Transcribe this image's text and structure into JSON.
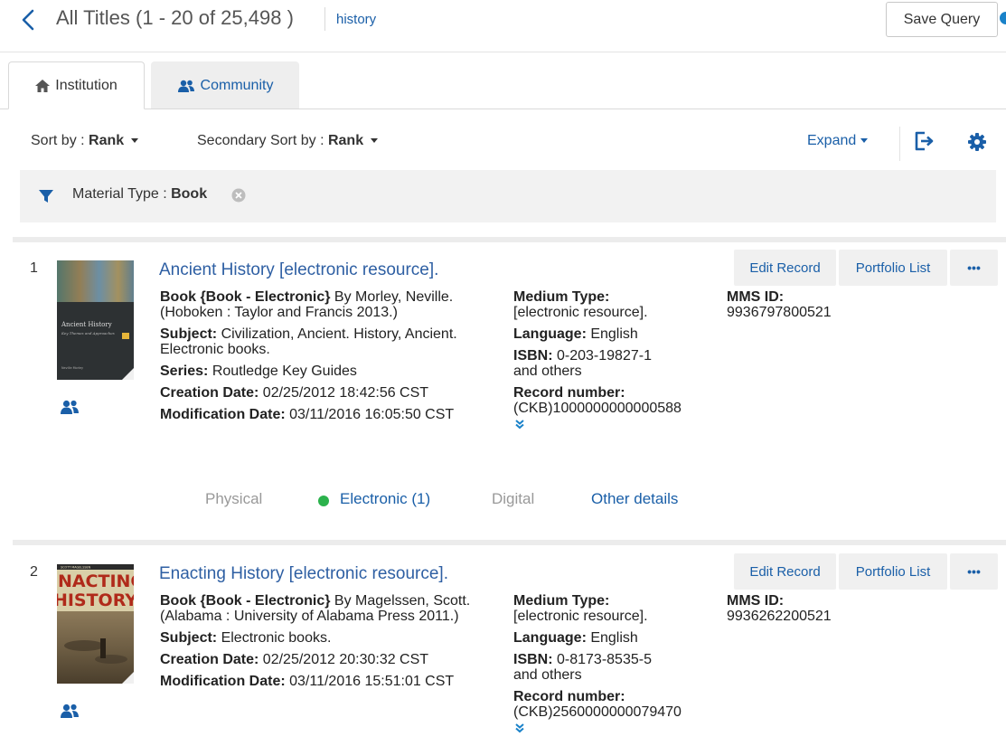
{
  "header": {
    "title": "All Titles (1 - 20 of 25,498 )",
    "query_term": "history",
    "save_query_label": "Save Query"
  },
  "tabs": [
    {
      "label": "Institution",
      "icon": "home-icon",
      "active": true
    },
    {
      "label": "Community",
      "icon": "users-icon",
      "active": false
    }
  ],
  "sort": {
    "sort_by_label": "Sort by : ",
    "sort_by_value": "Rank",
    "secondary_label": "Secondary Sort by : ",
    "secondary_value": "Rank",
    "expand_label": "Expand"
  },
  "filter": {
    "label": "Material Type : ",
    "value": "Book"
  },
  "colors": {
    "link": "#1a5fa8",
    "title_link": "#2e5fa3",
    "available_dot": "#2bb24c"
  },
  "results": [
    {
      "number": "1",
      "title": "Ancient History [electronic resource].",
      "book_type_label": "Book {Book - Electronic}",
      "book_line": " By Morley, Neville. (Hoboken : Taylor and Francis 2013.)",
      "subject_label": "Subject:",
      "subject": " Civilization, Ancient. History, Ancient. Electronic books.",
      "series_label": "Series:",
      "series": " Routledge Key Guides",
      "creation_label": "Creation Date:",
      "creation": " 02/25/2012 18:42:56 CST",
      "modification_label": "Modification Date:",
      "modification": " 03/11/2016 16:05:50 CST",
      "medium_label": "Medium Type:",
      "medium": "[electronic resource].",
      "language_label": "Language:",
      "language": " English",
      "isbn_label": "ISBN:",
      "isbn": " 0-203-19827-1",
      "isbn_more": "and others",
      "record_label": "Record number:",
      "record": "(CKB)1000000000000588",
      "mms_label": "MMS ID:",
      "mms": "9936797800521",
      "edit_label": "Edit Record",
      "portfolio_label": "Portfolio List",
      "more_label": "•••",
      "inventory": {
        "physical": "Physical",
        "electronic": "Electronic (1)",
        "digital": "Digital",
        "other": "Other details"
      }
    },
    {
      "number": "2",
      "title": "Enacting History [electronic resource].",
      "book_type_label": "Book {Book - Electronic}",
      "book_line": " By Magelssen, Scott. (Alabama : University of Alabama Press 2011.)",
      "subject_label": "Subject:",
      "subject": " Electronic books.",
      "creation_label": "Creation Date:",
      "creation": " 02/25/2012 20:30:32 CST",
      "modification_label": "Modification Date:",
      "modification": " 03/11/2016 15:51:01 CST",
      "medium_label": "Medium Type:",
      "medium": "[electronic resource].",
      "language_label": "Language:",
      "language": " English",
      "isbn_label": "ISBN:",
      "isbn": " 0-8173-8535-5",
      "isbn_more": "and others",
      "record_label": "Record number:",
      "record": "(CKB)2560000000079470",
      "mms_label": "MMS ID:",
      "mms": "9936262200521",
      "edit_label": "Edit Record",
      "portfolio_label": "Portfolio List",
      "more_label": "•••"
    }
  ],
  "covers": [
    {
      "title_lines": [
        "Ancient History",
        "Key Themes and Approaches"
      ],
      "author": "Neville Morley"
    },
    {
      "banner": "SCOTT MAGELSSEN",
      "title_lines": [
        "ENACTING",
        "HISTORY"
      ]
    }
  ]
}
